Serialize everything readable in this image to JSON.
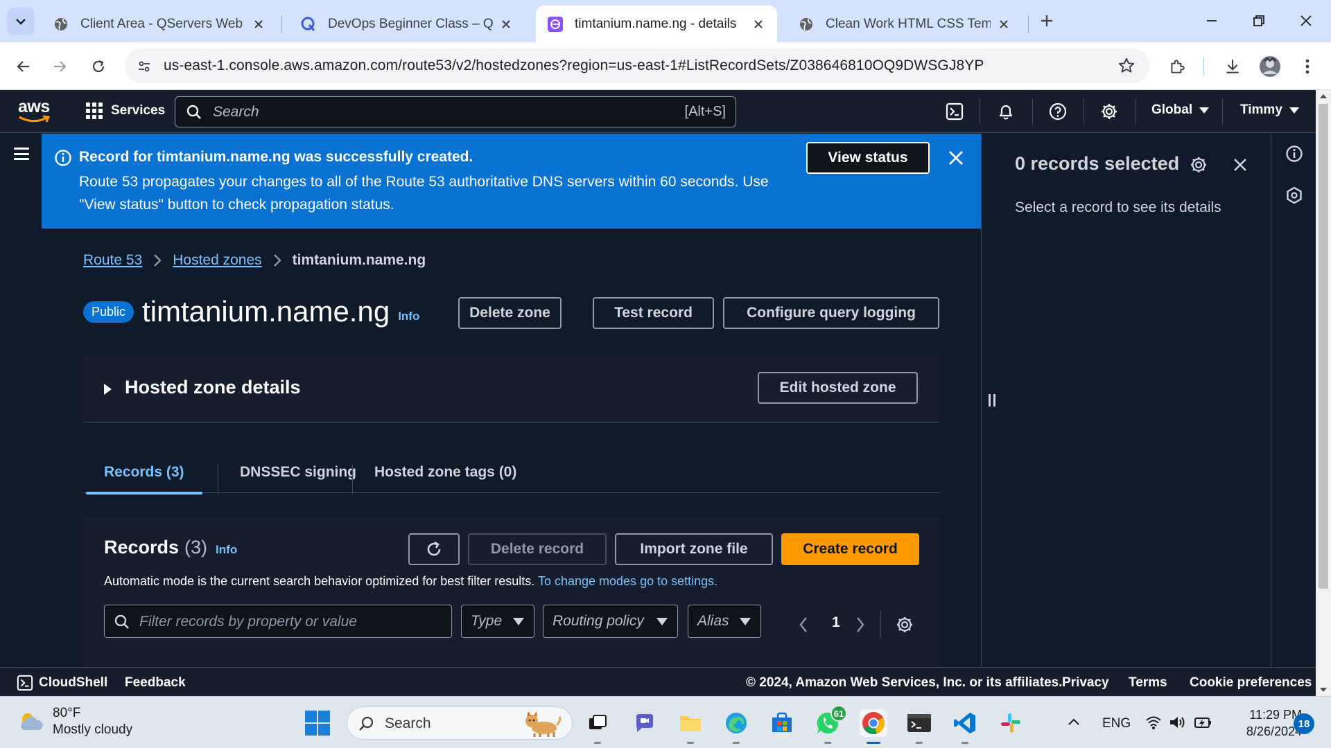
{
  "browser": {
    "tabs": [
      {
        "title": "Client Area - QServers Web Hos",
        "favicon": "globe-icon",
        "active": false
      },
      {
        "title": "DevOps Beginner Class – Quratı",
        "favicon": "quora-icon",
        "active": false
      },
      {
        "title": "timtanium.name.ng - details",
        "favicon": "route53-icon",
        "active": true
      },
      {
        "title": "Clean Work HTML CSS Template",
        "favicon": "globe-icon",
        "active": false
      }
    ],
    "url": "us-east-1.console.aws.amazon.com/route53/v2/hostedzones?region=us-east-1#ListRecordSets/Z038646810OQ9DWSGJ8YP"
  },
  "aws_nav": {
    "logo_text": "aws",
    "services_label": "Services",
    "search_placeholder": "Search",
    "search_shortcut": "[Alt+S]",
    "region_label": "Global",
    "user_label": "Timmy"
  },
  "flash": {
    "headline": "Record for timtanium.name.ng was successfully created.",
    "body": "Route 53 propagates your changes to all of the Route 53 authoritative DNS servers within 60 seconds. Use \"View status\" button to check propagation status.",
    "view_status_label": "View status",
    "color": "#0972d3"
  },
  "breadcrumbs": [
    {
      "label": "Route 53",
      "link": true
    },
    {
      "label": "Hosted zones",
      "link": true
    },
    {
      "label": "timtanium.name.ng",
      "link": false
    }
  ],
  "zone": {
    "badge": "Public",
    "title": "timtanium.name.ng",
    "info_label": "Info",
    "actions": {
      "delete_zone": "Delete zone",
      "test_record": "Test record",
      "configure_logging": "Configure query logging"
    },
    "details_heading": "Hosted zone details",
    "edit_label": "Edit hosted zone"
  },
  "zone_tabs": [
    {
      "label": "Records (3)",
      "active": true
    },
    {
      "label": "DNSSEC signing",
      "active": false
    },
    {
      "label": "Hosted zone tags (0)",
      "active": false
    }
  ],
  "records": {
    "heading": "Records",
    "count": "(3)",
    "info_label": "Info",
    "delete_label": "Delete record",
    "import_label": "Import zone file",
    "create_label": "Create record",
    "mode_hint": "Automatic mode is the current search behavior optimized for best filter results.",
    "mode_link": "To change modes go to settings.",
    "filter_placeholder": "Filter records by property or value",
    "filters": {
      "type": "Type",
      "routing": "Routing policy",
      "alias": "Alias"
    },
    "page": "1",
    "accent_color": "#ff9900"
  },
  "split_panel": {
    "title": "0 records selected",
    "hint": "Select a record to see its details"
  },
  "footer": {
    "cloudshell": "CloudShell",
    "feedback": "Feedback",
    "copyright": "© 2024, Amazon Web Services, Inc. or its affiliates.",
    "links": [
      "Privacy",
      "Terms",
      "Cookie preferences"
    ]
  },
  "taskbar": {
    "weather_temp": "80°F",
    "weather_desc": "Mostly cloudy",
    "search_label": "Search",
    "whatsapp_badge": "61",
    "language": "ENG",
    "time": "11:29 PM",
    "date": "8/26/2024",
    "notification_count": "18"
  }
}
